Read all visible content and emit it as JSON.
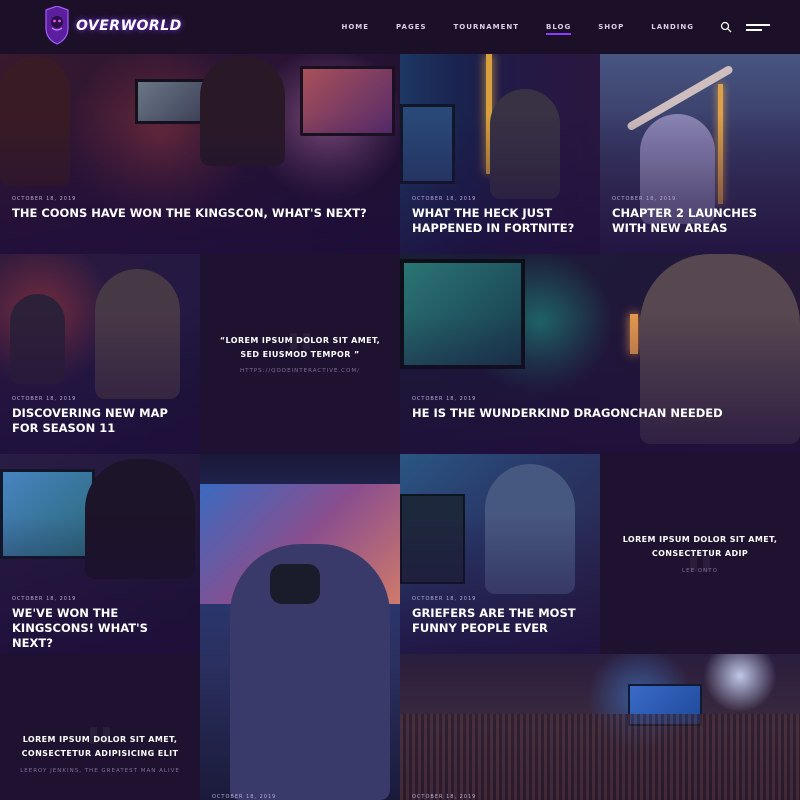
{
  "brand": {
    "name": "OVERWORLD"
  },
  "nav": {
    "items": [
      {
        "label": "HOME",
        "active": false
      },
      {
        "label": "PAGES",
        "active": false
      },
      {
        "label": "TOURNAMENT",
        "active": false
      },
      {
        "label": "BLOG",
        "active": true
      },
      {
        "label": "SHOP",
        "active": false
      },
      {
        "label": "LANDING",
        "active": false
      }
    ],
    "search_icon": "search-icon",
    "menu_icon": "hamburger-menu-icon"
  },
  "colors": {
    "background": "#1a1028",
    "accent": "#8a3cff",
    "tile_dark": "#1f1230"
  },
  "posts": [
    {
      "date": "OCTOBER 18, 2019",
      "title": "THE COONS HAVE WON THE KINGSCON, WHAT'S NEXT?"
    },
    {
      "date": "OCTOBER 18, 2019",
      "title": "WHAT THE HECK JUST HAPPENED IN FORTNITE?"
    },
    {
      "date": "OCTOBER 18, 2019",
      "title": "CHAPTER 2 LAUNCHES WITH NEW AREAS"
    },
    {
      "date": "OCTOBER 18, 2019",
      "title": "DISCOVERING NEW MAP FOR SEASON 11"
    },
    {
      "date": "OCTOBER 18, 2019",
      "title": "HE IS THE WUNDERKIND DRAGONCHAN NEEDED"
    },
    {
      "date": "OCTOBER 18, 2019",
      "title": "WE'VE WON THE KINGSCONS! WHAT'S NEXT?"
    },
    {
      "date": "OCTOBER 18, 2019",
      "title": "GRIEFERS ARE THE MOST FUNNY PEOPLE EVER"
    },
    {
      "date": "OCTOBER 18, 2019",
      "title": ""
    },
    {
      "date": "OCTOBER 18, 2019",
      "title": ""
    }
  ],
  "quotes": [
    {
      "text": "“LOREM IPSUM DOLOR SIT AMET, SED EIUSMOD TEMPOR ”",
      "author": "HTTPS://QODEINTERACTIVE.COM/"
    },
    {
      "text": "LOREM IPSUM DOLOR SIT AMET, CONSECTETUR ADIP",
      "author": "LEE ONTO"
    },
    {
      "text": "LOREM IPSUM DOLOR SIT AMET, CONSECTETUR ADIPISICING ELIT",
      "author": "LEEROY JENKINS, THE GREATEST MAN ALIVE"
    }
  ]
}
